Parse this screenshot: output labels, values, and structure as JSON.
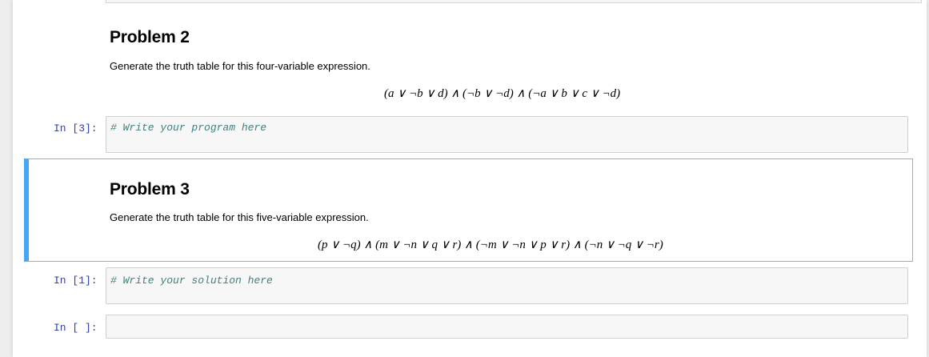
{
  "problem2": {
    "heading": "Problem 2",
    "description": "Generate the truth table for this four-variable expression.",
    "expression": "(a ∨ ¬b ∨ d) ∧ (¬b ∨ ¬d) ∧ (¬a ∨ b ∨ c ∨ ¬d)"
  },
  "cell3": {
    "prompt": "In [3]:",
    "code": "# Write your program here"
  },
  "problem3": {
    "heading": "Problem 3",
    "description": "Generate the truth table for this five-variable expression.",
    "expression": "(p ∨ ¬q) ∧ (m ∨ ¬n ∨ q ∨ r) ∧ (¬m ∨ ¬n ∨ p ∨ r) ∧ (¬n ∨ ¬q ∨ ¬r)"
  },
  "cell1": {
    "prompt": "In [1]:",
    "code": "# Write your solution here"
  },
  "cell_empty": {
    "prompt": "In [ ]:",
    "code": ""
  },
  "colors": {
    "selection_bar": "#42a5f5",
    "prompt_color": "#303f9f",
    "comment_color": "#408080",
    "code_bg": "#f7f7f7"
  }
}
